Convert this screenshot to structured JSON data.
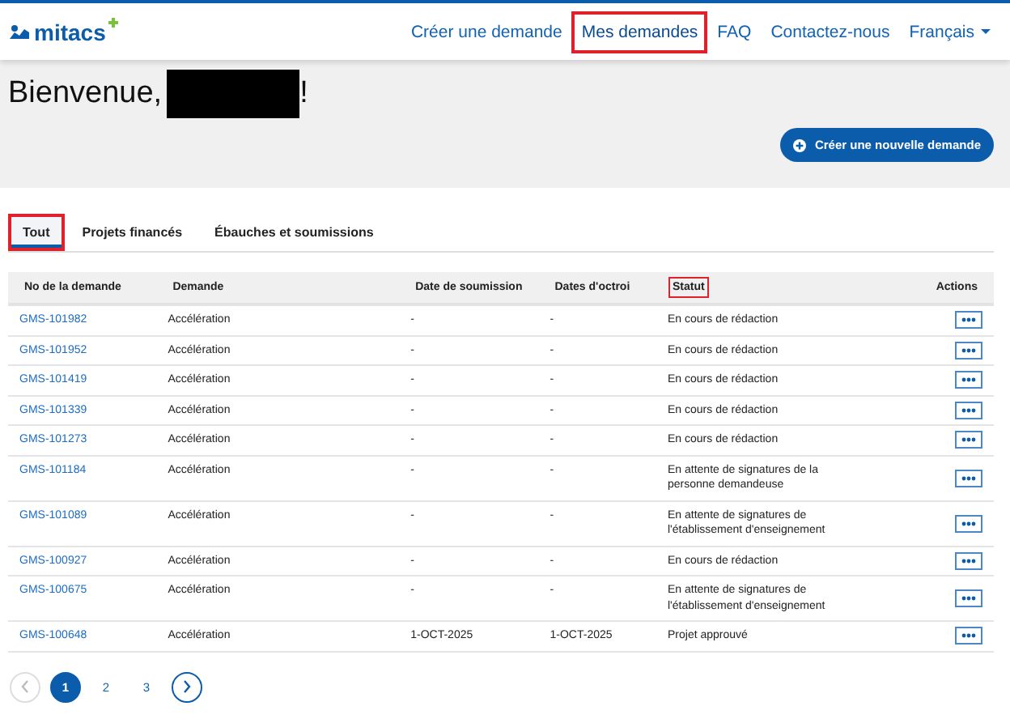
{
  "header": {
    "logo": "mitacs",
    "nav": [
      {
        "label": "Créer une demande",
        "selected": false,
        "annotated": false
      },
      {
        "label": "Mes demandes",
        "selected": true,
        "annotated": true
      },
      {
        "label": "FAQ",
        "selected": false,
        "annotated": false
      },
      {
        "label": "Contactez-nous",
        "selected": false,
        "annotated": false
      }
    ],
    "language": "Français"
  },
  "welcome": {
    "greeting": "Bienvenue,",
    "redacted": true,
    "suffix": "!"
  },
  "create_button": "Créer une nouvelle demande",
  "tabs": [
    {
      "label": "Tout",
      "selected": true,
      "annotated": true
    },
    {
      "label": "Projets financés",
      "selected": false,
      "annotated": false
    },
    {
      "label": "Ébauches et soumissions",
      "selected": false,
      "annotated": false
    }
  ],
  "table": {
    "columns": [
      {
        "label": "No de la demande",
        "annotated": false
      },
      {
        "label": "Demande",
        "annotated": false
      },
      {
        "label": "Date de soumission",
        "annotated": false
      },
      {
        "label": "Dates d'octroi",
        "annotated": false
      },
      {
        "label": "Statut",
        "annotated": true
      },
      {
        "label": "Actions",
        "annotated": false
      }
    ],
    "rows": [
      {
        "id": "GMS-101982",
        "type": "Accélération",
        "submitted": "-",
        "granted": "-",
        "status": "En cours de rédaction"
      },
      {
        "id": "GMS-101952",
        "type": "Accélération",
        "submitted": "-",
        "granted": "-",
        "status": "En cours de rédaction"
      },
      {
        "id": "GMS-101419",
        "type": "Accélération",
        "submitted": "-",
        "granted": "-",
        "status": "En cours de rédaction"
      },
      {
        "id": "GMS-101339",
        "type": "Accélération",
        "submitted": "-",
        "granted": "-",
        "status": "En cours de rédaction"
      },
      {
        "id": "GMS-101273",
        "type": "Accélération",
        "submitted": "-",
        "granted": "-",
        "status": "En cours de rédaction"
      },
      {
        "id": "GMS-101184",
        "type": "Accélération",
        "submitted": "-",
        "granted": "-",
        "status": "En attente de signatures de la personne demandeuse"
      },
      {
        "id": "GMS-101089",
        "type": "Accélération",
        "submitted": "-",
        "granted": "-",
        "status": "En attente de signatures de l'établissement d'enseignement"
      },
      {
        "id": "GMS-100927",
        "type": "Accélération",
        "submitted": "-",
        "granted": "-",
        "status": "En cours de rédaction"
      },
      {
        "id": "GMS-100675",
        "type": "Accélération",
        "submitted": "-",
        "granted": "-",
        "status": "En attente de signatures de l'établissement d'enseignement"
      },
      {
        "id": "GMS-100648",
        "type": "Accélération",
        "submitted": "1-OCT-2025",
        "granted": "1-OCT-2025",
        "status": "Projet approuvé"
      }
    ]
  },
  "pagination": {
    "pages": [
      {
        "label": "1",
        "selected": true
      },
      {
        "label": "2",
        "selected": false
      },
      {
        "label": "3",
        "selected": false
      }
    ],
    "prev_disabled": true
  }
}
